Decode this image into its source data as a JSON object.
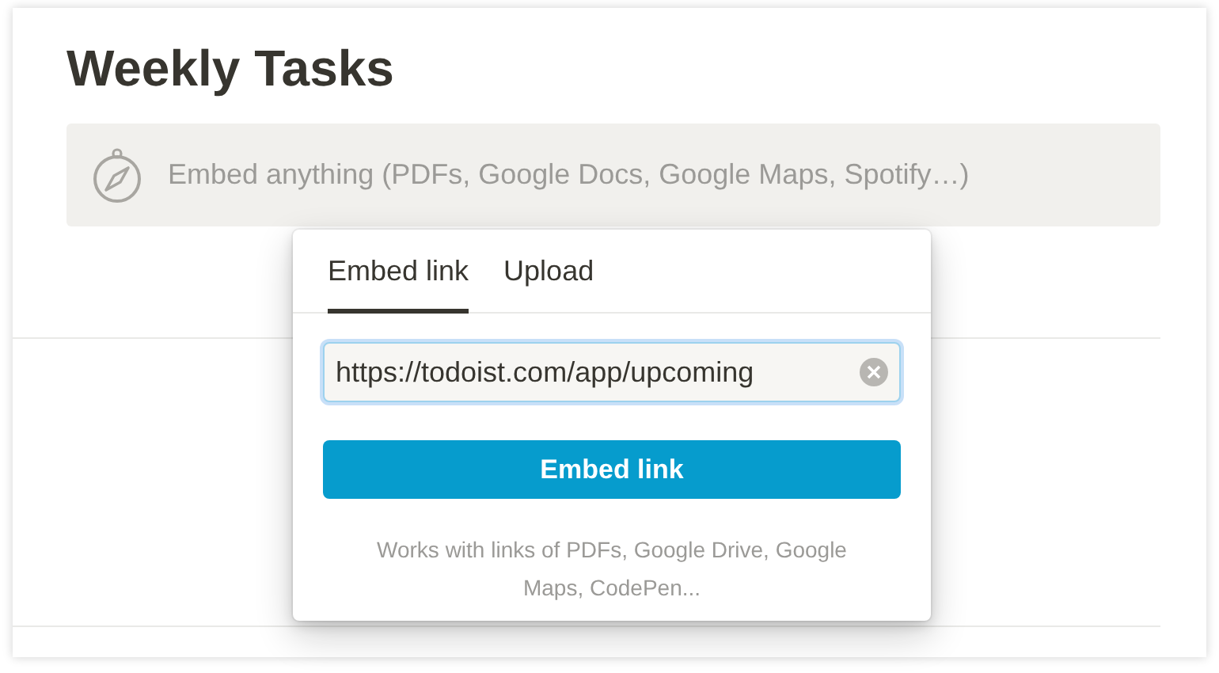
{
  "page": {
    "title": "Weekly Tasks"
  },
  "embed_block": {
    "placeholder": "Embed anything (PDFs, Google Docs, Google Maps, Spotify…)"
  },
  "popup": {
    "tabs": [
      {
        "label": "Embed link",
        "selected": true
      },
      {
        "label": "Upload",
        "selected": false
      }
    ],
    "link_field": {
      "value": "https://todoist.com/app/upcoming"
    },
    "button": "Embed link",
    "hint": "Works with links of PDFs, Google Drive, Google Maps, CodePen..."
  }
}
